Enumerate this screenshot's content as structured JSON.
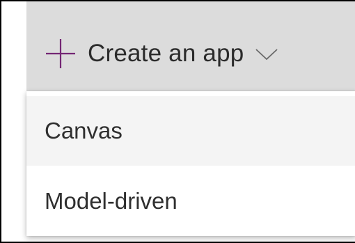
{
  "create_button": {
    "label": "Create an app",
    "icon": "plus-icon",
    "dropdown_icon": "chevron-down-icon",
    "accent_color": "#742774"
  },
  "menu": {
    "items": [
      {
        "label": "Canvas"
      },
      {
        "label": "Model-driven"
      }
    ]
  }
}
